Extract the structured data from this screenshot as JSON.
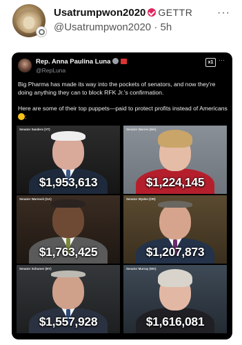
{
  "post": {
    "author_name": "Usatrumpwon2020",
    "platform": "GETTR",
    "handle": "@Usatrumpwon2020",
    "time": "· 5h",
    "more": "···"
  },
  "embed": {
    "author_name": "Rep. Anna Paulina Luna",
    "handle": "@RepLuna",
    "badge_xl": "x1",
    "more": "···",
    "paragraph1": "Big Pharma has made its way into the pockets of senators, and now they're doing anything they can to block RFK Jr.'s confirmation.",
    "paragraph2": "Here are some of their top puppets—paid to protect profits instead of Americans",
    "paragraph2_suffix": ":"
  },
  "tiles": [
    {
      "label": "Senator Sanders (VT)",
      "amount": "$1,953,613"
    },
    {
      "label": "Senator Warren (MA)",
      "amount": "$1,224,145"
    },
    {
      "label": "Senator Warnock (GA)",
      "amount": "$1,763,425"
    },
    {
      "label": "Senator Wyden (OR)",
      "amount": "$1,207,873"
    },
    {
      "label": "Senator Schumer (NY)",
      "amount": "$1,557,928"
    },
    {
      "label": "Senator Murray (WA)",
      "amount": "$1,616,081"
    }
  ],
  "colors": {
    "card_bg": "#000000",
    "verified_red": "#e0245e",
    "emoji_yellow": "#f4c21b"
  },
  "icons": [
    "user-avatar",
    "verified-icon",
    "more-icon",
    "xl-badge-icon",
    "flag-icon",
    "grimace-emoji-icon"
  ]
}
